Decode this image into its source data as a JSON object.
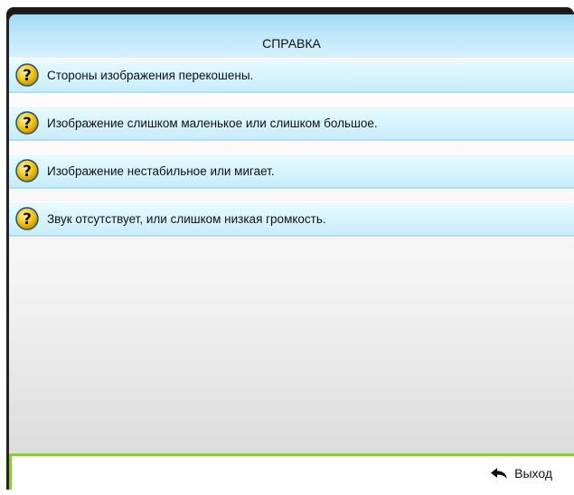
{
  "header": {
    "title": "СПРАВКА"
  },
  "items": [
    {
      "label": "Стороны изображения перекошены.",
      "icon": "help-question-icon"
    },
    {
      "label": "Изображение слишком маленькое или слишком большое.",
      "icon": "help-question-icon"
    },
    {
      "label": "Изображение нестабильное или мигает.",
      "icon": "help-question-icon"
    },
    {
      "label": "Звук отсутствует, или слишком низкая громкость.",
      "icon": "help-question-icon"
    }
  ],
  "footer": {
    "exit_label": "Выход",
    "exit_icon": "back-arrow-icon"
  },
  "colors": {
    "header_gradient_top": "#9fd9f4",
    "row_gradient": "#d6f3fd",
    "footer_accent": "#8dc63f",
    "icon_fill": "#f5c400"
  }
}
